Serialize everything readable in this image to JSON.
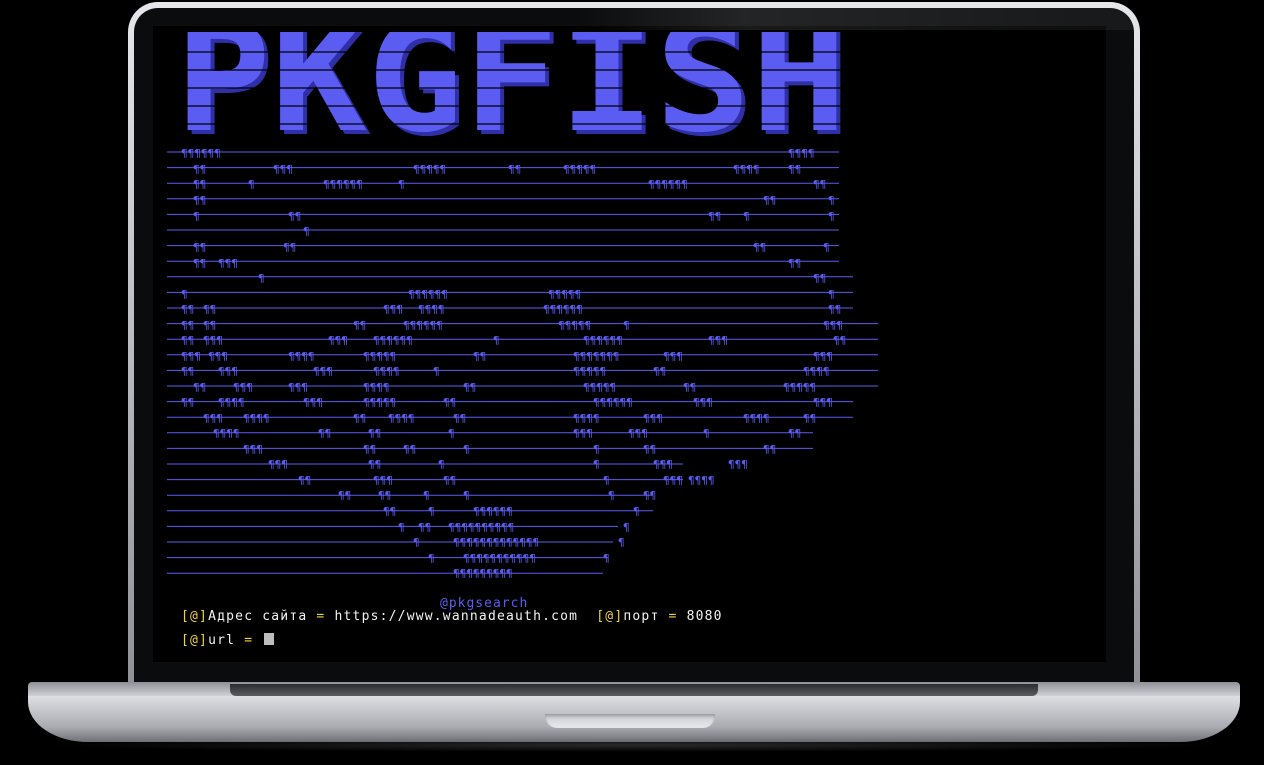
{
  "banner": {
    "title": "PKGFISH",
    "color": "#5b5cf2",
    "shade": "#2f30a8"
  },
  "art": {
    "glyph": "¶",
    "color": "#5b5cf2"
  },
  "handle": "@pkgsearch",
  "prompt": {
    "bracket": "[@]",
    "site_label": "Адрес сайта",
    "eq": " = ",
    "site_value": "https://www.wannadeauth.com",
    "port_label": "порт",
    "port_value": "8080",
    "url_label": "url"
  },
  "colors": {
    "accent": "#5b5cf2",
    "prompt_yellow": "#f0d43a",
    "text": "#f2f2f2",
    "background": "#000000"
  }
}
